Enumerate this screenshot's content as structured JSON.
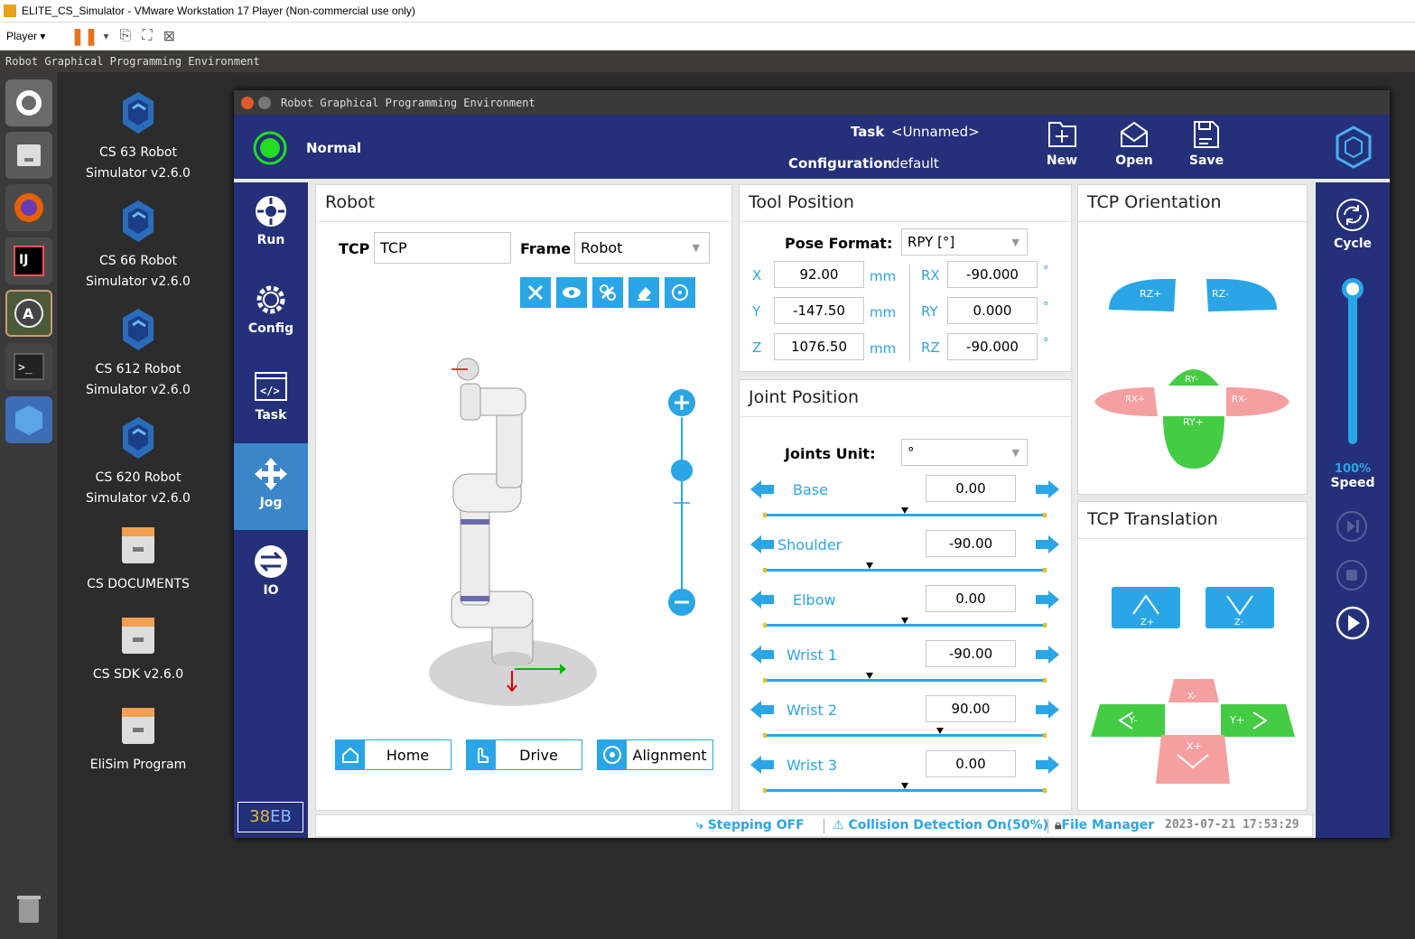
{
  "vm": {
    "title": "ELITE_CS_Simulator - VMware Workstation 17 Player (Non-commercial use only)",
    "player_label": "Player"
  },
  "ubuntu_bar": {
    "title": "Robot Graphical Programming Environment"
  },
  "desktop": {
    "icons": [
      {
        "label": "CS 63 Robot Simulator v2.6.0",
        "l1": "CS 63 Robot",
        "l2": "Simulator v2.6.0"
      },
      {
        "label": "CS 66 Robot Simulator v2.6.0",
        "l1": "CS 66 Robot",
        "l2": "Simulator v2.6.0"
      },
      {
        "label": "CS 612 Robot Simulator v2.6.0",
        "l1": "CS 612 Robot",
        "l2": "Simulator v2.6.0"
      },
      {
        "label": "CS 620 Robot Simulator v2.6.0",
        "l1": "CS 620 Robot",
        "l2": "Simulator v2.6.0"
      },
      {
        "label": "CS DOCUMENTS",
        "l1": "CS DOCUMENTS",
        "l2": ""
      },
      {
        "label": "CS SDK v2.6.0",
        "l1": "CS SDK v2.6.0",
        "l2": ""
      },
      {
        "label": "EliSim Program",
        "l1": "EliSim Program",
        "l2": ""
      }
    ]
  },
  "app": {
    "title": "Robot Graphical Programming Environment",
    "header": {
      "status": "Normal",
      "task_label": "Task",
      "task_value": "<Unnamed>",
      "config_label": "Configuration",
      "config_value": "default",
      "new": "New",
      "open": "Open",
      "save": "Save"
    },
    "nav": {
      "run": "Run",
      "config": "Config",
      "task": "Task",
      "jog": "Jog",
      "io": "IO",
      "code_a": "38",
      "code_b": "EB"
    },
    "robot": {
      "title": "Robot",
      "tcp_label": "TCP",
      "tcp_value": "TCP",
      "frame_label": "Frame",
      "frame_value": "Robot",
      "home": "Home",
      "drive": "Drive",
      "alignment": "Alignment"
    },
    "tool_position": {
      "title": "Tool Position",
      "pose_label": "Pose Format:",
      "pose_value": "RPY [°]",
      "x_label": "X",
      "x": "92.00",
      "y_label": "Y",
      "y": "-147.50",
      "z_label": "Z",
      "z": "1076.50",
      "unit_mm": "mm",
      "rx_label": "RX",
      "rx": "-90.000",
      "ry_label": "RY",
      "ry": "0.000",
      "rz_label": "RZ",
      "rz": "-90.000",
      "unit_deg": "°"
    },
    "joint_position": {
      "title": "Joint Position",
      "unit_label": "Joints Unit:",
      "unit_value": "°",
      "joints": [
        {
          "name": "Base",
          "value": "0.00",
          "fraction": 0.5
        },
        {
          "name": "Shoulder",
          "value": "-90.00",
          "fraction": 0.375
        },
        {
          "name": "Elbow",
          "value": "0.00",
          "fraction": 0.5
        },
        {
          "name": "Wrist 1",
          "value": "-90.00",
          "fraction": 0.375
        },
        {
          "name": "Wrist 2",
          "value": "90.00",
          "fraction": 0.625
        },
        {
          "name": "Wrist 3",
          "value": "0.00",
          "fraction": 0.5
        }
      ]
    },
    "tcp_orientation": {
      "title": "TCP Orientation",
      "rz_plus": "RZ+",
      "rz_minus": "RZ-",
      "rx_plus": "RX+",
      "rx_minus": "RX-",
      "ry_plus": "RY+",
      "ry_minus": "RY-"
    },
    "tcp_translation": {
      "title": "TCP Translation",
      "z_plus": "Z+",
      "z_minus": "Z-",
      "x_plus": "X+",
      "x_minus": "X-",
      "y_plus": "Y+",
      "y_minus": "Y-"
    },
    "right": {
      "cycle": "Cycle",
      "speed_percent": "100%",
      "speed_label": "Speed",
      "speed_fraction": 1.0
    },
    "status": {
      "stepping": "Stepping OFF",
      "collision": "Collision Detection On(50%)",
      "file_manager": "File Manager",
      "datetime": "2023-07-21 17:53:29"
    }
  },
  "colors": {
    "navy": "#24307a",
    "accent": "#2aa6e6",
    "green": "#44cc44",
    "red": "#f5a0a0"
  }
}
